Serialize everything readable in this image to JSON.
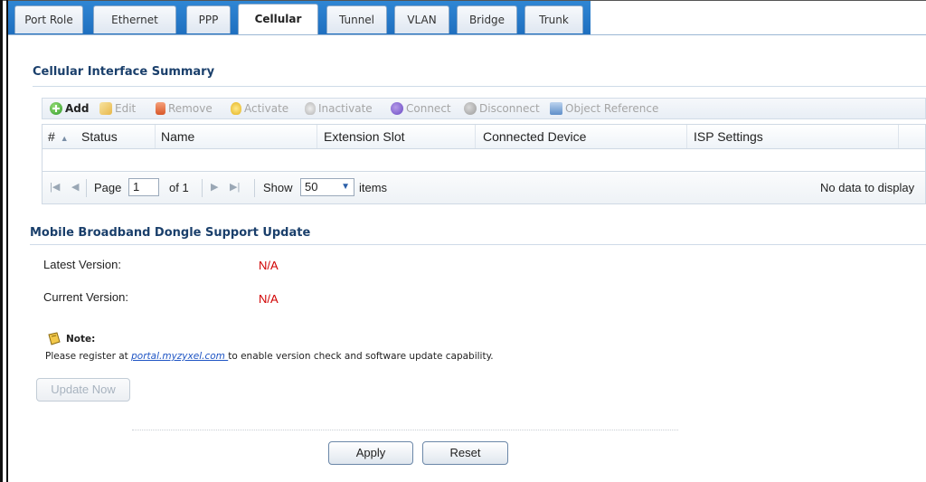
{
  "tabs": [
    {
      "label": "Port Role"
    },
    {
      "label": "Ethernet"
    },
    {
      "label": "PPP"
    },
    {
      "label": "Cellular"
    },
    {
      "label": "Tunnel"
    },
    {
      "label": "VLAN"
    },
    {
      "label": "Bridge"
    },
    {
      "label": "Trunk"
    }
  ],
  "active_tab": "Cellular",
  "summary": {
    "title": "Cellular Interface Summary",
    "toolbar": {
      "add": "Add",
      "edit": "Edit",
      "remove": "Remove",
      "activate": "Activate",
      "inactivate": "Inactivate",
      "connect": "Connect",
      "disconnect": "Disconnect",
      "object_reference": "Object Reference"
    },
    "columns": [
      "#",
      "Status",
      "Name",
      "Extension Slot",
      "Connected Device",
      "ISP Settings"
    ],
    "sort_indicator": "▲",
    "pager": {
      "page_label": "Page",
      "page_value": "1",
      "of_label": "of 1",
      "show_label": "Show",
      "show_value": "50",
      "items_label": "items",
      "empty_text": "No data to display"
    }
  },
  "dongle": {
    "title": "Mobile Broadband Dongle Support Update",
    "latest_label": "Latest Version:",
    "latest_value": "N/A",
    "current_label": "Current Version:",
    "current_value": "N/A",
    "note_label": "Note:",
    "note_prefix": "Please register at ",
    "note_link": "portal.myzyxel.com ",
    "note_suffix": "to enable version check and software update capability.",
    "update_button": "Update Now"
  },
  "footer": {
    "apply": "Apply",
    "reset": "Reset"
  },
  "colors": {
    "tabbar": "#2f86d4",
    "section_title": "#1a3f6b",
    "na_value": "#d00000",
    "link": "#1f55c4"
  },
  "icons": {
    "add": "add-icon",
    "edit": "edit-icon",
    "remove": "remove-icon",
    "activate": "bulb-on-icon",
    "inactivate": "bulb-off-icon",
    "connect": "connect-icon",
    "disconnect": "disconnect-icon",
    "object_reference": "object-reference-icon",
    "note": "note-icon"
  }
}
